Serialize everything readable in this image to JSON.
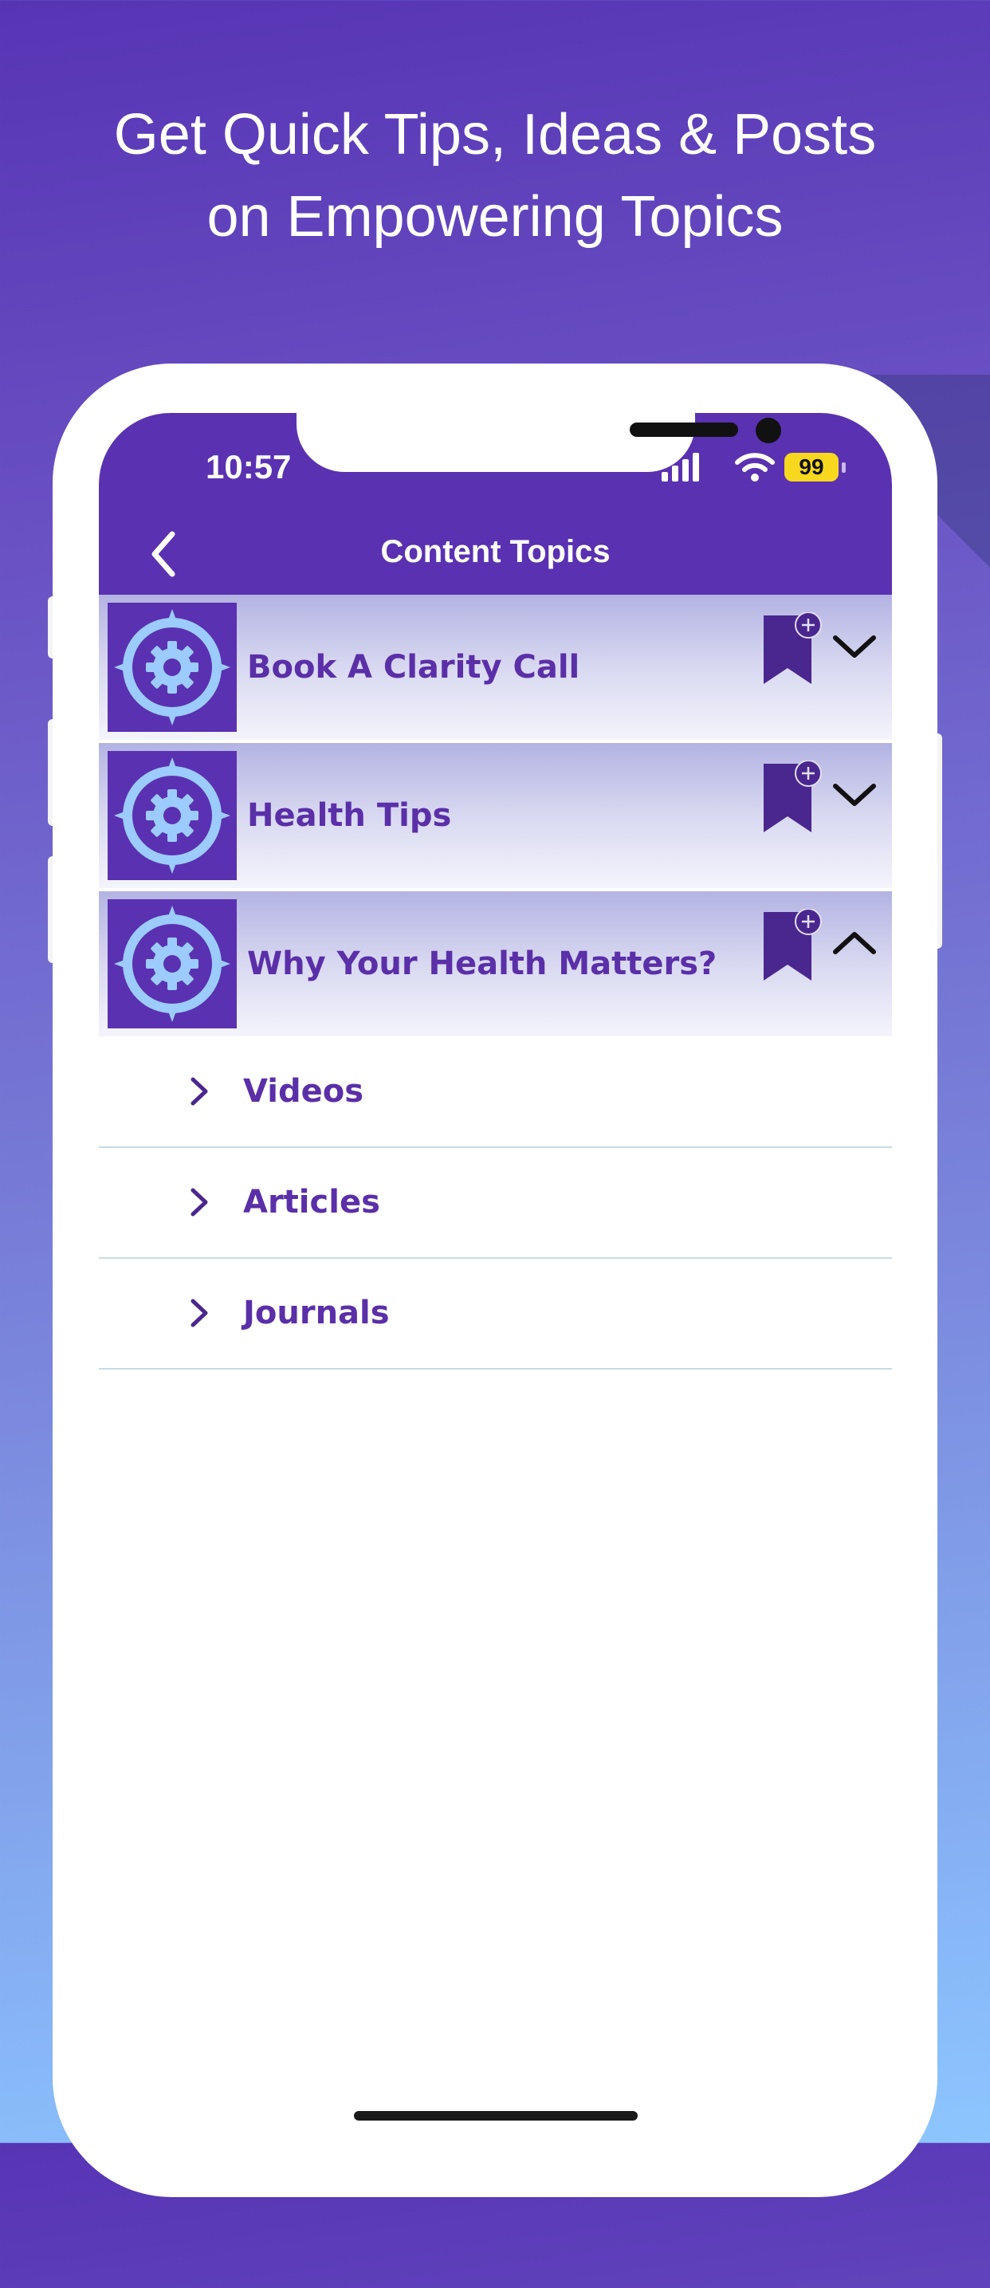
{
  "promo": {
    "headline_line1": "Get Quick Tips, Ideas & Posts",
    "headline_line2": "on Empowering Topics"
  },
  "status_bar": {
    "time": "10:57",
    "battery": "99"
  },
  "header": {
    "title": "Content Topics",
    "back_icon": "chevron-left-icon"
  },
  "topics": [
    {
      "title": "Book A Clarity Call",
      "expanded": false
    },
    {
      "title": "Health Tips",
      "expanded": false
    },
    {
      "title": "Why Your Health Matters?",
      "expanded": true
    }
  ],
  "subitems": [
    {
      "label": "Videos"
    },
    {
      "label": "Articles"
    },
    {
      "label": "Journals"
    }
  ],
  "colors": {
    "brand_purple": "#5a31b1",
    "text_purple": "#5a2fa8",
    "icon_light_blue": "#9ccbff",
    "battery_yellow": "#f7d81e"
  }
}
